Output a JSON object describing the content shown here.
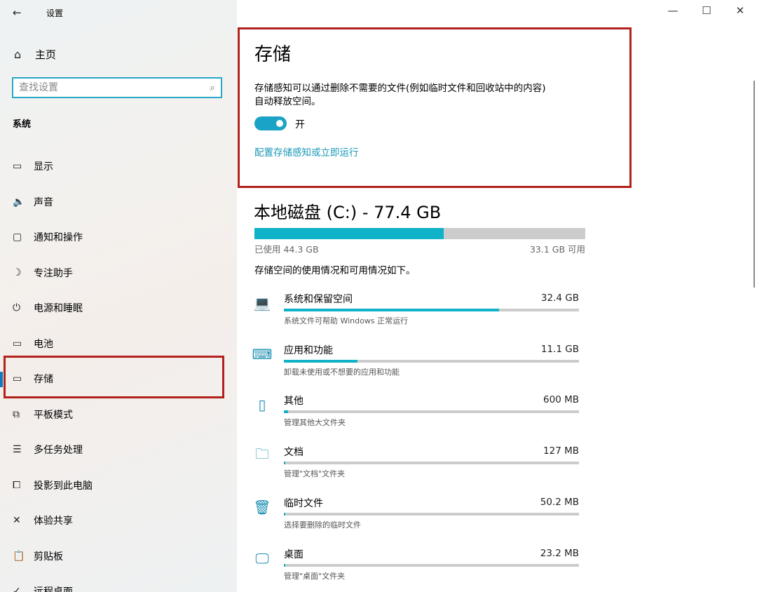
{
  "window": {
    "title": "设置",
    "back_icon": "back-arrow-icon",
    "controls": {
      "minimize": "—",
      "maximize": "☐",
      "close": "✕"
    }
  },
  "sidebar": {
    "home_label": "主页",
    "search_placeholder": "查找设置",
    "section_title": "系统",
    "items": [
      {
        "label": "显示",
        "icon": "display-icon",
        "glyph": "▭"
      },
      {
        "label": "声音",
        "icon": "speaker-icon",
        "glyph": "🔈"
      },
      {
        "label": "通知和操作",
        "icon": "notification-icon",
        "glyph": "▢"
      },
      {
        "label": "专注助手",
        "icon": "moon-icon",
        "glyph": "☽"
      },
      {
        "label": "电源和睡眠",
        "icon": "power-icon",
        "glyph": "⏻"
      },
      {
        "label": "电池",
        "icon": "battery-icon",
        "glyph": "▭"
      },
      {
        "label": "存储",
        "icon": "storage-icon",
        "glyph": "▭",
        "selected": true
      },
      {
        "label": "平板模式",
        "icon": "tablet-icon",
        "glyph": "⧉"
      },
      {
        "label": "多任务处理",
        "icon": "multitask-icon",
        "glyph": "☰"
      },
      {
        "label": "投影到此电脑",
        "icon": "project-icon",
        "glyph": "⧠"
      },
      {
        "label": "体验共享",
        "icon": "share-icon",
        "glyph": "✕"
      },
      {
        "label": "剪贴板",
        "icon": "clipboard-icon",
        "glyph": "📋"
      },
      {
        "label": "远程桌面",
        "icon": "remote-desktop-icon",
        "glyph": "✓"
      }
    ]
  },
  "main": {
    "title": "存储",
    "storage_sense_desc_line1": "存储感知可以通过删除不需要的文件(例如临时文件和回收站中的内容)",
    "storage_sense_desc_line2": "自动释放空间。",
    "toggle_state": "开",
    "toggle_on": true,
    "config_link": "配置存储感知或立即运行",
    "disk": {
      "title": "本地磁盘 (C:) - 77.4 GB",
      "used_label": "已使用 44.3 GB",
      "free_label": "33.1 GB 可用",
      "used_fraction": 0.572,
      "description": "存储空间的使用情况和可用情况如下。"
    },
    "categories": [
      {
        "name": "系统和保留空间",
        "size": "32.4 GB",
        "sub": "系统文件可帮助 Windows 正常运行",
        "fraction": 0.73,
        "icon": "laptop-icon"
      },
      {
        "name": "应用和功能",
        "size": "11.1 GB",
        "sub": "卸载未使用或不想要的应用和功能",
        "fraction": 0.25,
        "icon": "keyboard-icon"
      },
      {
        "name": "其他",
        "size": "600 MB",
        "sub": "管理其他大文件夹",
        "fraction": 0.014,
        "icon": "other-files-icon"
      },
      {
        "name": "文档",
        "size": "127 MB",
        "sub": "管理\"文档\"文件夹",
        "fraction": 0.003,
        "icon": "documents-folder-icon"
      },
      {
        "name": "临时文件",
        "size": "50.2 MB",
        "sub": "选择要删除的临时文件",
        "fraction": 0.0015,
        "icon": "trash-icon"
      },
      {
        "name": "桌面",
        "size": "23.2 MB",
        "sub": "管理\"桌面\"文件夹",
        "fraction": 0.0008,
        "icon": "desktop-monitor-icon"
      }
    ]
  },
  "colors": {
    "accent": "#1aa3c5",
    "bar_fill": "#0fb2c8",
    "highlight_border": "#b2211c",
    "link": "#1a98b8"
  }
}
